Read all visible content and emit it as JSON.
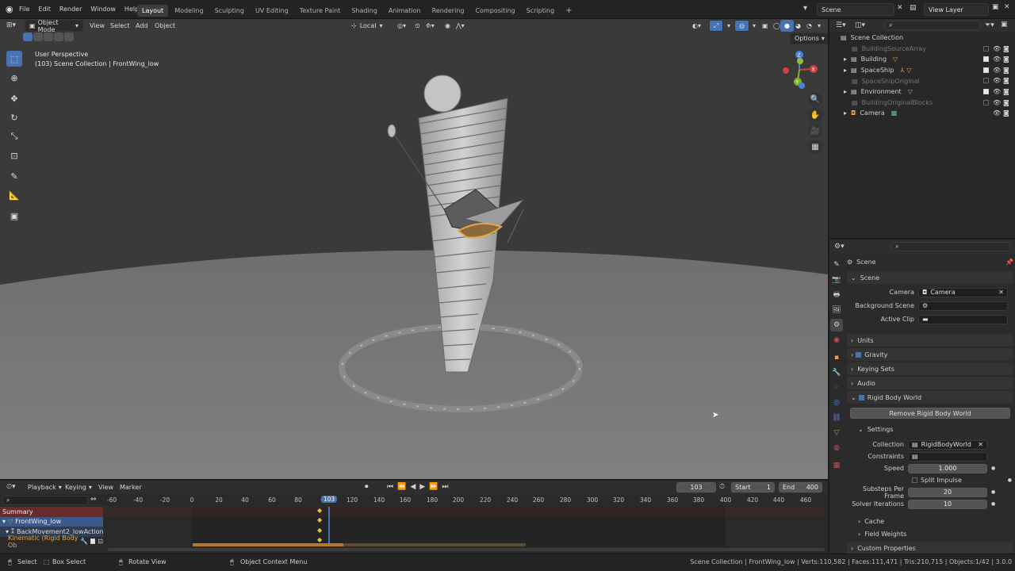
{
  "topbar": {
    "menus": [
      "File",
      "Edit",
      "Render",
      "Window",
      "Help"
    ],
    "workspaces": [
      "Layout",
      "Modeling",
      "Sculpting",
      "UV Editing",
      "Texture Paint",
      "Shading",
      "Animation",
      "Rendering",
      "Compositing",
      "Scripting"
    ],
    "active_workspace": "Layout",
    "scene": "Scene",
    "view_layer": "View Layer"
  },
  "viewport": {
    "mode": "Object Mode",
    "menus": [
      "View",
      "Select",
      "Add",
      "Object"
    ],
    "transform_orientation": "Local",
    "options_label": "Options",
    "perspective_label": "User Perspective",
    "object_info": "(103) Scene Collection | FrontWing_low",
    "gizmo": {
      "x": "X",
      "y": "Y",
      "z": "Z"
    }
  },
  "outliner": {
    "root": "Scene Collection",
    "items": [
      {
        "name": "BuildingSourceArray",
        "dim": true,
        "expand": false
      },
      {
        "name": "Building",
        "dim": false,
        "expand": true
      },
      {
        "name": "SpaceShip",
        "dim": false,
        "expand": true
      },
      {
        "name": "SpaceShipOriginal",
        "dim": true,
        "expand": false
      },
      {
        "name": "Environment",
        "dim": false,
        "expand": true
      },
      {
        "name": "BuildingOriginalBlocks",
        "dim": true,
        "expand": false
      },
      {
        "name": "Camera",
        "dim": false,
        "expand": true
      }
    ]
  },
  "properties": {
    "context": "Scene",
    "scene_panel": "Scene",
    "camera_label": "Camera",
    "camera_value": "Camera",
    "background_scene_label": "Background Scene",
    "active_clip_label": "Active Clip",
    "panels": [
      "Units",
      "Gravity",
      "Keying Sets",
      "Audio"
    ],
    "rigid_body_world": "Rigid Body World",
    "remove_rbw_button": "Remove Rigid Body World",
    "settings": "Settings",
    "collection_label": "Collection",
    "collection_value": "RigidBodyWorld",
    "constraints_label": "Constraints",
    "speed_label": "Speed",
    "speed_value": "1.000",
    "split_impulse": "Split Impulse",
    "substeps_label": "Substeps Per Frame",
    "substeps_value": "20",
    "solver_label": "Solver Iterations",
    "solver_value": "10",
    "cache": "Cache",
    "field_weights": "Field Weights",
    "custom_properties": "Custom Properties"
  },
  "timeline": {
    "menus": [
      "Playback",
      "Keying",
      "View",
      "Marker"
    ],
    "current_frame": "103",
    "start_label": "Start",
    "start_value": "1",
    "end_label": "End",
    "end_value": "400",
    "ticks": [
      "-60",
      "-40",
      "-20",
      "0",
      "20",
      "40",
      "60",
      "80",
      "103",
      "120",
      "140",
      "160",
      "180",
      "200",
      "220",
      "240",
      "260",
      "280",
      "300",
      "320",
      "340",
      "360",
      "380",
      "400",
      "420",
      "440",
      "460"
    ],
    "channels": {
      "summary": "Summary",
      "object": "FrontWing_low",
      "action": "BackMovement2_lowAction",
      "kinematic": "Kinematic (Rigid Body Ob"
    }
  },
  "statusbar": {
    "select": "Select",
    "box_select": "Box Select",
    "rotate_view": "Rotate View",
    "context_menu": "Object Context Menu",
    "stats": "Scene Collection | FrontWing_low | Verts:110,582 | Faces:111,471 | Tris:210,715 | Objects:1/42 | 3.0.0"
  },
  "colors": {
    "accent": "#4772b3",
    "selection": "#e8a34a",
    "keyframe": "#e8c23a"
  }
}
